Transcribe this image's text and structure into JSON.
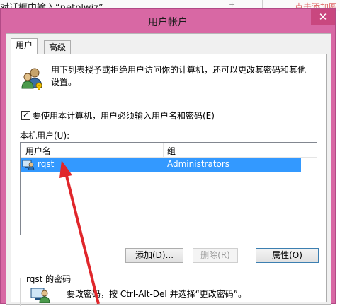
{
  "background": {
    "instruction_text": "对话框中输入“netplwiz”",
    "add_picture_text": "点击添加图"
  },
  "dialog": {
    "title": "用户帐户",
    "close_symbol": "✕",
    "tabs": [
      {
        "label": "用户",
        "selected": true
      },
      {
        "label": "高级",
        "selected": false
      }
    ],
    "intro_text": "用下列表授予或拒绝用户访问你的计算机，还可以更改其密码和其他设置。",
    "require_login_checkbox": {
      "label": "要使用本计算机，用户必须输入用户名和密码(E)",
      "checked": true
    },
    "local_users_label": "本机用户(U):",
    "user_list": {
      "columns": [
        "用户名",
        "组"
      ],
      "rows": [
        {
          "name": "rqst",
          "group": "Administrators",
          "selected": true
        }
      ]
    },
    "buttons": {
      "add": "添加(D)...",
      "remove": "删除(R)",
      "properties": "属性(O)"
    },
    "password_section": {
      "title": "rqst 的密码",
      "text": "要改密码，按 Ctrl-Alt-Del 并选择“更改密码”。"
    }
  },
  "colors": {
    "window_frame": "#d868a4",
    "selection": "#3399ff",
    "annotation_arrow": "#e0262b"
  }
}
